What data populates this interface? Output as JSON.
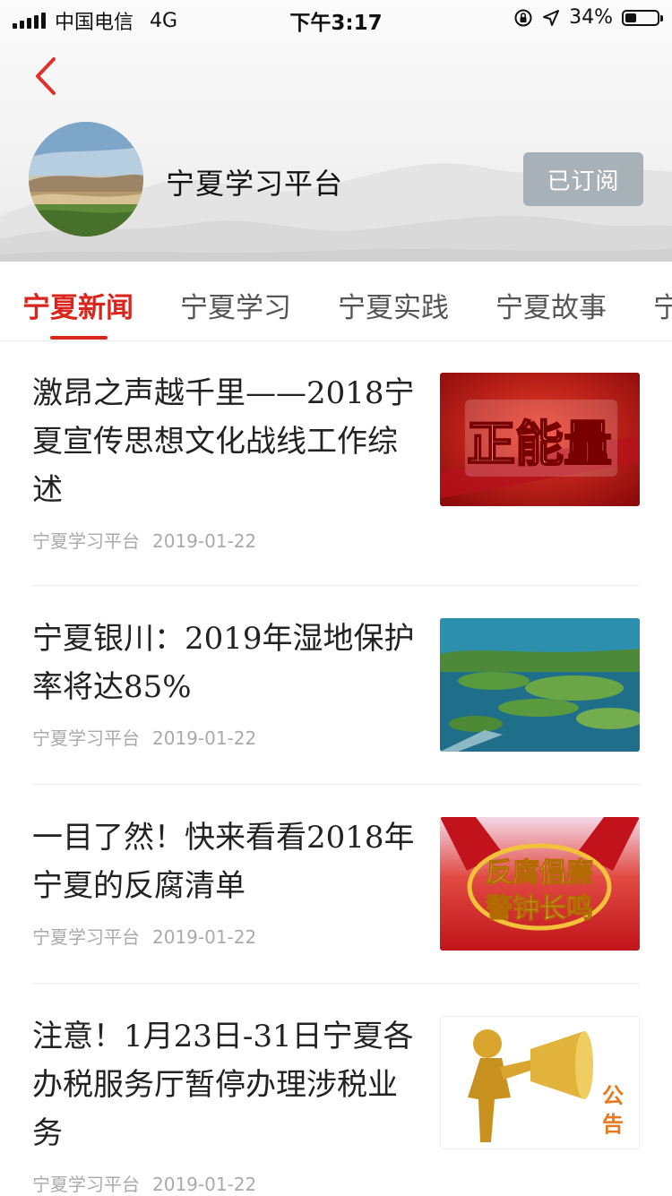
{
  "status_bar": {
    "carrier": "中国电信",
    "network": "4G",
    "time": "下午3:17",
    "battery": "34%",
    "battery_level": 0.34
  },
  "header": {
    "channel_name": "宁夏学习平台",
    "subscribe_label": "已订阅",
    "icons": {
      "back": "chevron-left-icon",
      "avatar": "landscape-avatar"
    },
    "colors": {
      "accent": "#d9261c",
      "subscribed_button": "#a8b0b8"
    }
  },
  "tabs": [
    {
      "label": "宁夏新闻",
      "active": true
    },
    {
      "label": "宁夏学习",
      "active": false
    },
    {
      "label": "宁夏实践",
      "active": false
    },
    {
      "label": "宁夏故事",
      "active": false
    },
    {
      "label": "宁",
      "active": false
    }
  ],
  "articles": [
    {
      "title": "激昂之声越千里——2018宁夏宣传思想文化战线工作综述",
      "source": "宁夏学习平台",
      "date": "2019-01-22",
      "thumbnail_text": "正能量"
    },
    {
      "title": "宁夏银川：2019年湿地保护率将达85%",
      "source": "宁夏学习平台",
      "date": "2019-01-22",
      "thumbnail_text": ""
    },
    {
      "title": "一目了然！快来看看2018年宁夏的反腐清单",
      "source": "宁夏学习平台",
      "date": "2019-01-22",
      "thumbnail_text": "反腐倡廉警钟长鸣"
    },
    {
      "title": "注意！1月23日-31日宁夏各办税服务厅暂停办理涉税业务",
      "source": "宁夏学习平台",
      "date": "2019-01-22",
      "thumbnail_text": "公告"
    }
  ]
}
